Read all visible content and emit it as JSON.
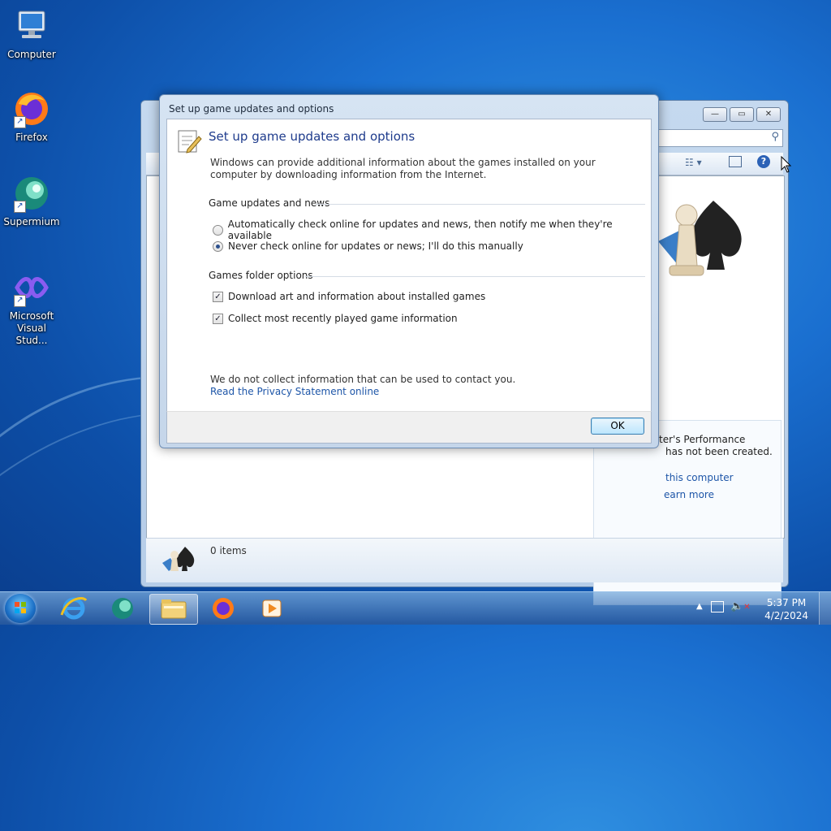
{
  "desktop": {
    "icons": [
      {
        "label": "Computer",
        "icon": "computer-icon"
      },
      {
        "label": "Firefox",
        "icon": "firefox-icon"
      },
      {
        "label": "Supermium",
        "icon": "supermium-icon"
      },
      {
        "label": "Microsoft Visual Stud...",
        "icon": "visual-studio-icon"
      }
    ]
  },
  "background_window": {
    "right_pane": {
      "line1": "ter's Performance",
      "line2": "has not been created.",
      "link1": "this computer",
      "link2": "earn more"
    },
    "status": {
      "items": "0 items"
    }
  },
  "dialog": {
    "title": "Set up game updates and options",
    "heading": "Set up game updates and options",
    "intro": "Windows can provide additional information about the games installed on your computer by downloading information from the Internet.",
    "updates_group": "Game updates and news",
    "radio_auto": "Automatically check online for updates and news, then notify me when they're available",
    "radio_never": "Never check online for updates or news; I'll do this manually",
    "radio_selected": "never",
    "folder_group": "Games folder options",
    "chk_art": "Download art and information about installed games",
    "chk_art_checked": true,
    "chk_recent": "Collect most recently played game information",
    "chk_recent_checked": true,
    "note": "We do not collect information that can be used to contact you.",
    "privacy_link": "Read the Privacy Statement online",
    "ok_label": "OK"
  },
  "taskbar": {
    "time": "5:37 PM",
    "date": "4/2/2024",
    "items": [
      "internet-explorer-icon",
      "supermium-icon",
      "file-explorer-icon",
      "firefox-icon",
      "media-player-icon"
    ]
  }
}
